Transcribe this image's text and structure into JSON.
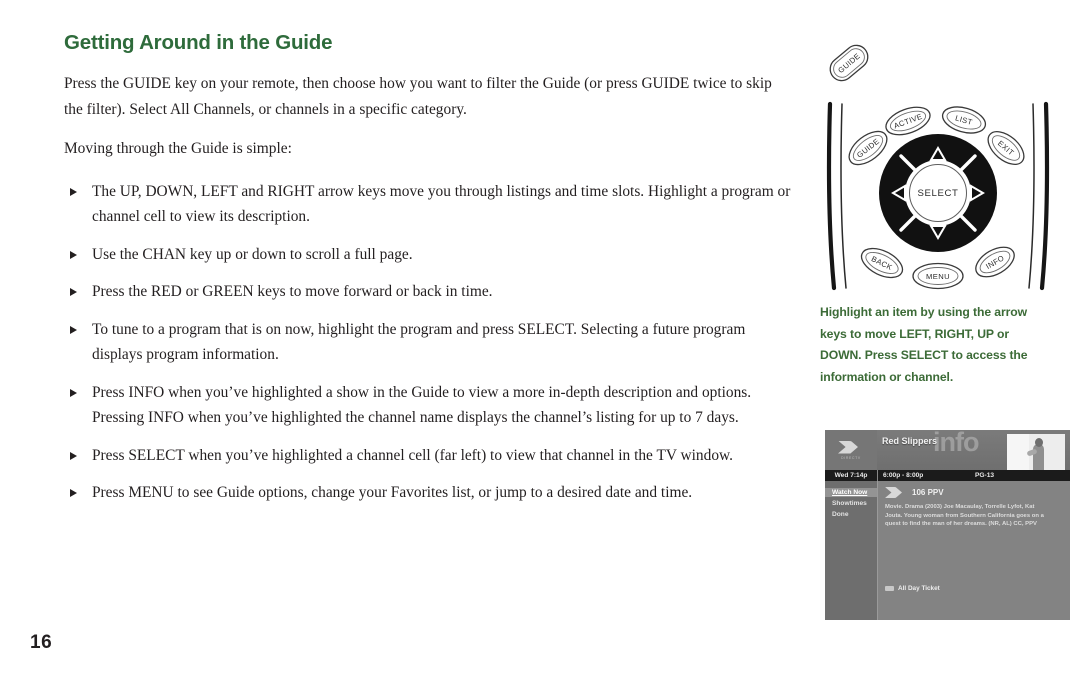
{
  "page": {
    "number": "16",
    "title": "Getting Around in the Guide"
  },
  "colors": {
    "heading_green": "#2e6b3b",
    "caption_green": "#3c6b37",
    "body_text": "#231f20"
  },
  "intro": {
    "paragraph_1": "Press the GUIDE key on your remote, then choose how you want to filter the Guide (or press GUIDE twice to skip the filter). Select All Channels, or channels in a specific category.",
    "paragraph_2": "Moving through the Guide is simple:"
  },
  "bullets": [
    "The UP, DOWN, LEFT and RIGHT arrow keys move you through listings and time slots. Highlight a program or channel cell to view its description.",
    "Use the CHAN key up or down to scroll a full page.",
    "Press the RED or GREEN keys to move forward or back in time.",
    "To tune to a program that is on now, highlight the program and press SELECT. Selecting a future program displays program information.",
    "Press INFO when you’ve highlighted a show in the Guide to view a more in-depth description and options. Pressing INFO when you’ve highlighted the channel name displays the channel’s listing for up to 7 days.",
    "Press SELECT when you’ve highlighted a channel cell (far left) to view that channel in the TV window.",
    "Press MENU to see Guide options, change your Favorites list, or jump to a desired date and time."
  ],
  "remote": {
    "callout_button": "GUIDE",
    "buttons": {
      "guide": "GUIDE",
      "active": "ACTIVE",
      "list": "LIST",
      "exit": "EXIT",
      "select": "SELECT",
      "back": "BACK",
      "menu": "MENU",
      "info": "INFO"
    },
    "caption": "Highlight an item by using the arrow keys to move LEFT, RIGHT, UP or DOWN. Press SELECT to access the information or channel."
  },
  "tv_screen": {
    "program_title": "Red Slippers",
    "watermark": "info",
    "date": "Wed 7:14p",
    "times": "6:00p - 8:00p",
    "rating": "PG-13",
    "brand": "DIRECTV",
    "menu_items": [
      "Watch Now",
      "Showtimes",
      "Done"
    ],
    "channel": "106 PPV",
    "description": "Movie. Drama (2003) Joe Macaulay, Torrelle Lyfot, Kat Jouta. Young woman from Southern California goes on a quest to find the man of her dreams. (NR, AL) CC, PPV",
    "footer_label": "All Day Ticket"
  }
}
